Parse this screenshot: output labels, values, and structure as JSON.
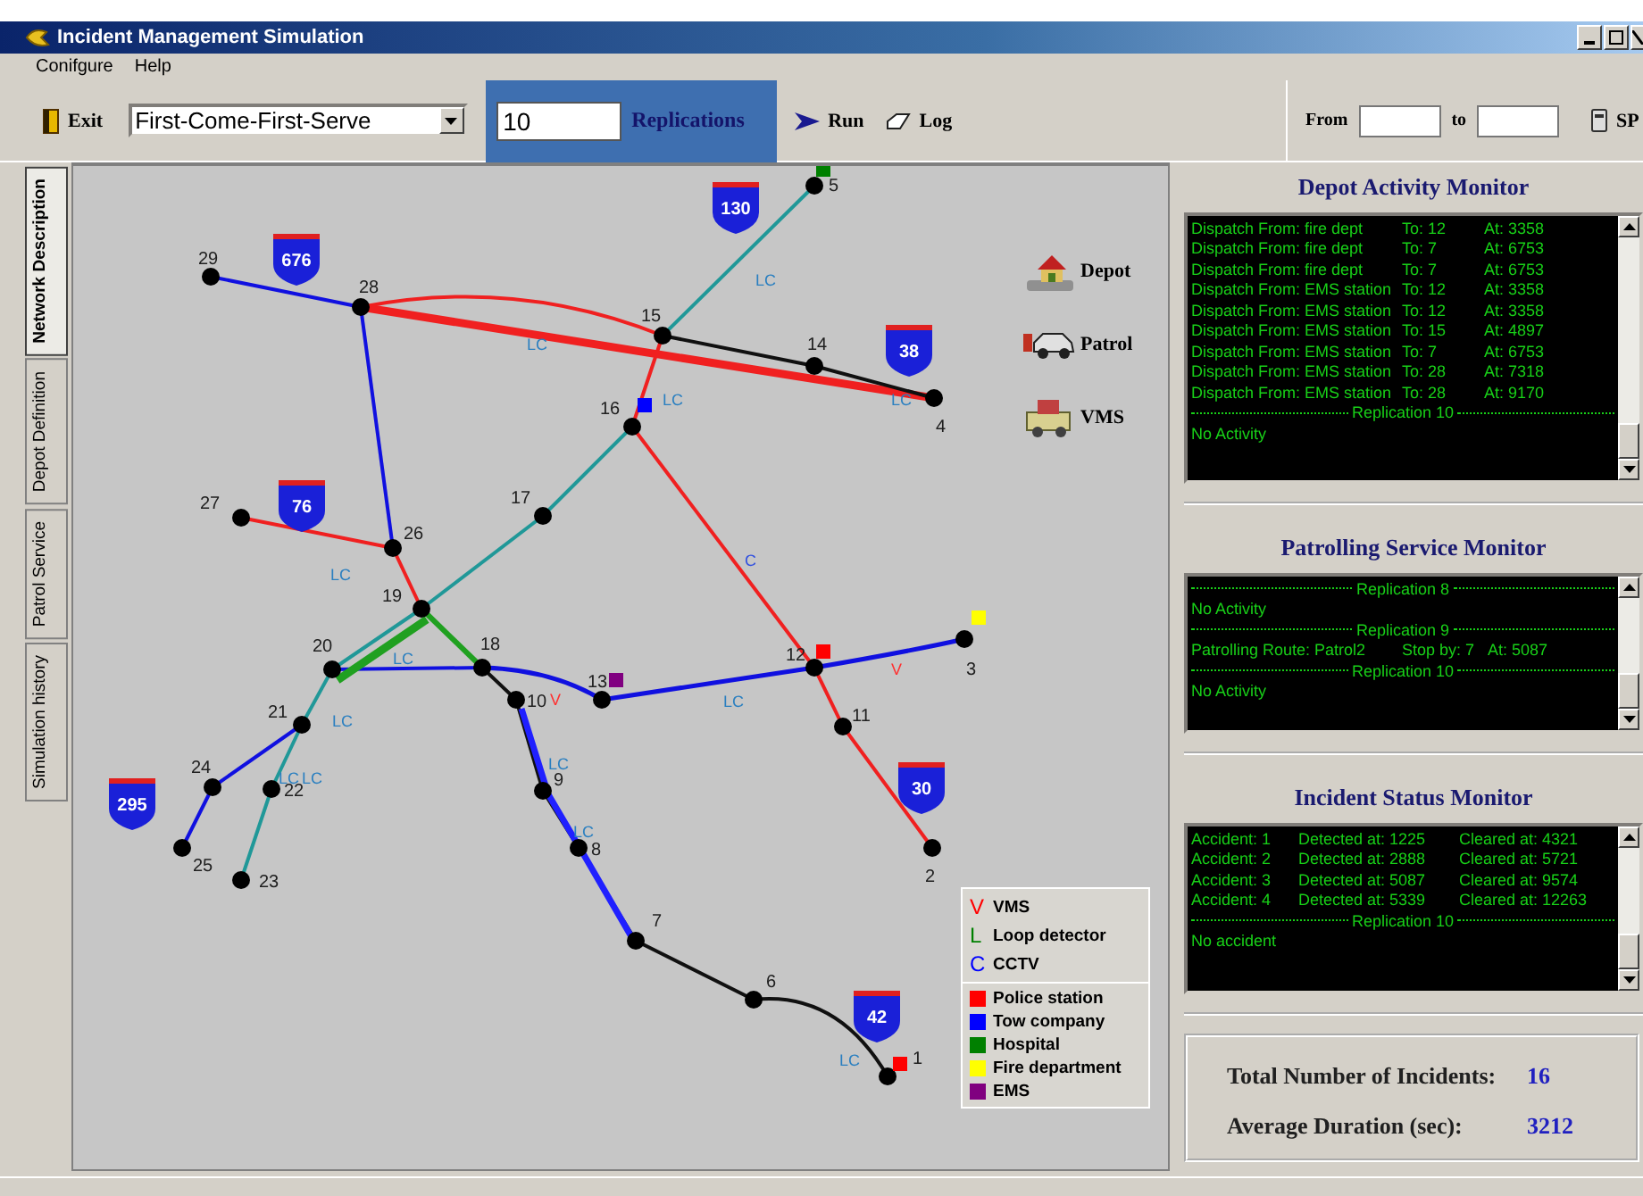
{
  "window": {
    "title": "Incident Management Simulation"
  },
  "menu": [
    "Conifgure",
    "Help"
  ],
  "toolbar": {
    "exit": "Exit",
    "policy": "First-Come-First-Serve",
    "replications": "10",
    "replications_label": "Replications",
    "run": "Run",
    "log": "Log",
    "from_label": "From",
    "to_label": "to",
    "sp": "SP"
  },
  "side_tabs": [
    {
      "label": "Network Description",
      "selected": true
    },
    {
      "label": "Depot Definition",
      "selected": false
    },
    {
      "label": "Patrol Service",
      "selected": false
    },
    {
      "label": "Simulation history",
      "selected": false
    }
  ],
  "map": {
    "nodes": [
      {
        "label": "1",
        "color": "#ff0000"
      },
      {
        "label": "2"
      },
      {
        "label": "3",
        "color": "#ffff00"
      },
      {
        "label": "4"
      },
      {
        "label": "5",
        "color": "#008000"
      },
      {
        "label": "6"
      },
      {
        "label": "7"
      },
      {
        "label": "8"
      },
      {
        "label": "9"
      },
      {
        "label": "10"
      },
      {
        "label": "11"
      },
      {
        "label": "12",
        "color": "#ff0000"
      },
      {
        "label": "13",
        "color": "#800080"
      },
      {
        "label": "14"
      },
      {
        "label": "15"
      },
      {
        "label": "16",
        "color": "#0000ff"
      },
      {
        "label": "17"
      },
      {
        "label": "18"
      },
      {
        "label": "19"
      },
      {
        "label": "20"
      },
      {
        "label": "21"
      },
      {
        "label": "22"
      },
      {
        "label": "23"
      },
      {
        "label": "24"
      },
      {
        "label": "25"
      },
      {
        "label": "26"
      },
      {
        "label": "27"
      },
      {
        "label": "28"
      },
      {
        "label": "29"
      }
    ],
    "shields": [
      "676",
      "130",
      "38",
      "76",
      "295",
      "30",
      "42"
    ],
    "sensors": [
      {
        "text": "LC",
        "kind": "lc"
      },
      {
        "text": "LC",
        "kind": "lc"
      },
      {
        "text": "LC",
        "kind": "lc"
      },
      {
        "text": "LC",
        "kind": "lc"
      },
      {
        "text": "C",
        "kind": "c"
      },
      {
        "text": "LC",
        "kind": "lc"
      },
      {
        "text": "LC",
        "kind": "lc"
      },
      {
        "text": "LC",
        "kind": "lc"
      },
      {
        "text": "LC",
        "kind": "lc"
      },
      {
        "text": "V",
        "kind": "v"
      },
      {
        "text": "V",
        "kind": "v"
      },
      {
        "text": "LC",
        "kind": "lc"
      },
      {
        "text": "LC",
        "kind": "lc"
      },
      {
        "text": "LC",
        "kind": "lc"
      },
      {
        "text": "LC",
        "kind": "lc"
      },
      {
        "text": "LC",
        "kind": "lc"
      }
    ],
    "tools": [
      {
        "label": "Depot",
        "kind": "depot"
      },
      {
        "label": "Patrol",
        "kind": "patrol"
      },
      {
        "label": "VMS",
        "kind": "vms"
      }
    ],
    "legend": {
      "sensors": [
        {
          "symbol": "V",
          "label": "VMS",
          "color": "#ff0000"
        },
        {
          "symbol": "L",
          "label": "Loop detector",
          "color": "#008000"
        },
        {
          "symbol": "C",
          "label": "CCTV",
          "color": "#0000ff"
        }
      ],
      "depots": [
        {
          "label": "Police station",
          "color": "#ff0000"
        },
        {
          "label": "Tow company",
          "color": "#0000ff"
        },
        {
          "label": "Hospital",
          "color": "#008000"
        },
        {
          "label": "Fire department",
          "color": "#ffff00"
        },
        {
          "label": "EMS",
          "color": "#800080"
        }
      ]
    }
  },
  "monitors": [
    {
      "title": "Depot Activity Monitor",
      "lines": [
        {
          "kind": "entry",
          "cells": [
            "Dispatch From: fire dept",
            "To: 12",
            "At: 3358"
          ]
        },
        {
          "kind": "entry",
          "cells": [
            "Dispatch From: fire dept",
            "To: 7",
            "At: 6753"
          ]
        },
        {
          "kind": "entry",
          "cells": [
            "Dispatch From: fire dept",
            "To: 7",
            "At: 6753"
          ]
        },
        {
          "kind": "entry",
          "cells": [
            "Dispatch From: EMS station",
            "To: 12",
            "At: 3358"
          ]
        },
        {
          "kind": "entry",
          "cells": [
            "Dispatch From: EMS station",
            "To: 12",
            "At: 3358"
          ]
        },
        {
          "kind": "entry",
          "cells": [
            "Dispatch From: EMS station",
            "To: 15",
            "At: 4897"
          ]
        },
        {
          "kind": "entry",
          "cells": [
            "Dispatch From: EMS station",
            "To: 7",
            "At: 6753"
          ]
        },
        {
          "kind": "entry",
          "cells": [
            "Dispatch From: EMS station",
            "To: 28",
            "At: 7318"
          ]
        },
        {
          "kind": "entry",
          "cells": [
            "Dispatch From: EMS station",
            "To: 28",
            "At: 9170"
          ]
        },
        {
          "kind": "separator",
          "text": "Replication 10"
        },
        {
          "kind": "note",
          "text": "No Activity"
        }
      ]
    },
    {
      "title": "Patrolling Service Monitor",
      "lines": [
        {
          "kind": "separator",
          "text": "Replication 8"
        },
        {
          "kind": "note",
          "text": "No Activity"
        },
        {
          "kind": "separator",
          "text": "Replication 9"
        },
        {
          "kind": "entry",
          "cells": [
            "Patrolling Route: Patrol2",
            "Stop by: 7",
            "At: 5087"
          ]
        },
        {
          "kind": "separator",
          "text": "Replication 10"
        },
        {
          "kind": "note",
          "text": "No Activity"
        }
      ]
    },
    {
      "title": "Incident Status Monitor",
      "lines": [
        {
          "kind": "entry",
          "cells": [
            "Accident: 1",
            "Detected at: 1225",
            "Cleared at: 4321"
          ]
        },
        {
          "kind": "entry",
          "cells": [
            "Accident: 2",
            "Detected at: 2888",
            "Cleared at: 5721"
          ]
        },
        {
          "kind": "entry",
          "cells": [
            "Accident: 3",
            "Detected at: 5087",
            "Cleared at: 9574"
          ]
        },
        {
          "kind": "entry",
          "cells": [
            "Accident: 4",
            "Detected at: 5339",
            "Cleared at: 12263"
          ]
        },
        {
          "kind": "separator",
          "text": "Replication 10"
        },
        {
          "kind": "note",
          "text": "No accident"
        }
      ]
    }
  ],
  "summary": [
    {
      "label": "Total Number of Incidents:",
      "value": "16"
    },
    {
      "label": "Average Duration (sec):",
      "value": "3212"
    }
  ]
}
